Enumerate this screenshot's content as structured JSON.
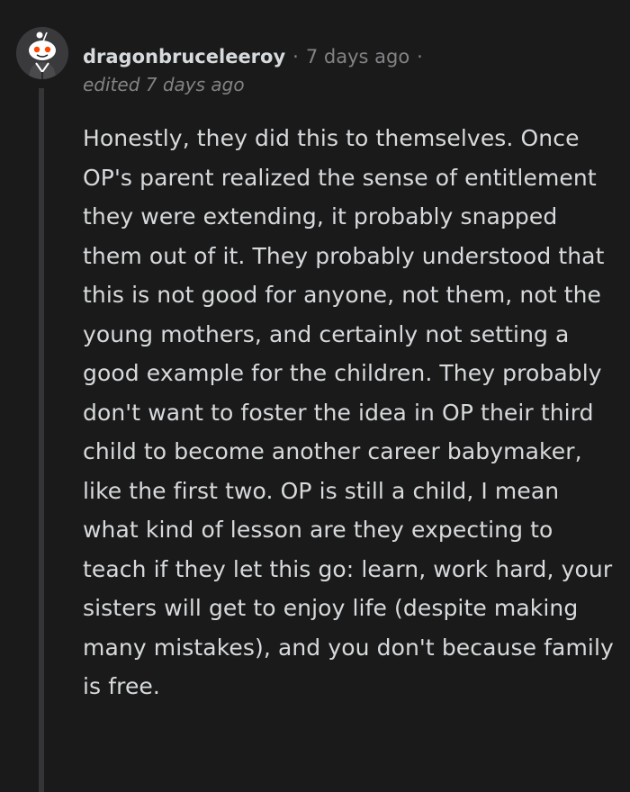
{
  "comment": {
    "avatar_icon": "reddit-snoo-avatar-icon",
    "username": "dragonbruceleeroy",
    "separator": "·",
    "timestamp": "7 days ago",
    "edited": "edited 7 days ago",
    "body": "Honestly, they did this to themselves. Once OP's parent realized the sense of entitlement they were extending, it probably snapped them out of it. They probably understood that this is not good for anyone, not them, not the young mothers, and certainly not setting a good example for the children. They probably don't want to foster the idea in OP their third child to become another career babymaker, like the first two. OP is still a child, I mean what kind of lesson are they expecting to teach if they let this go: learn, work hard, your sisters will get to enjoy life (despite making many mistakes), and you don't because family is free."
  },
  "colors": {
    "background": "#1a1a1b",
    "text": "#d7dadc",
    "muted": "#818384",
    "thread_line": "#343536"
  }
}
